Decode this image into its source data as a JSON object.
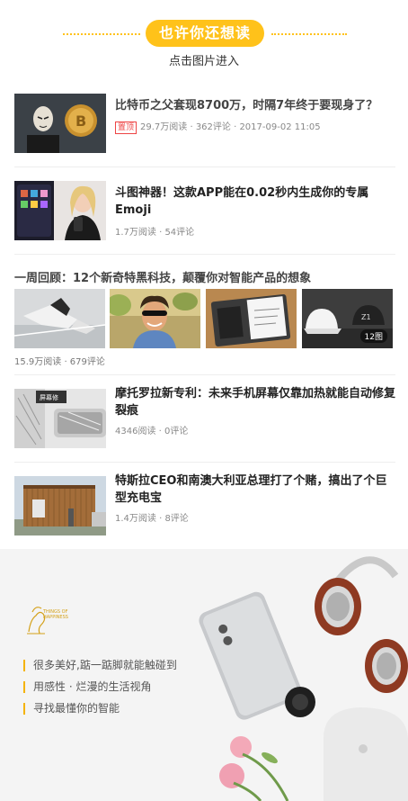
{
  "header": {
    "pill_label": "也许你还想读",
    "subtitle": "点击图片进入"
  },
  "articles": [
    {
      "title": "比特币之父套现8700万，时隔7年终于要现身了？",
      "tag": "置顶",
      "meta": "29.7万阅读 · 362评论 · 2017-09-02 11:05"
    },
    {
      "title": "斗图神器！这款APP能在0.02秒内生成你的专属Emoji",
      "meta": "1.7万阅读 · 54评论"
    },
    {
      "title": "摩托罗拉新专利：未来手机屏幕仅靠加热就能自动修复裂痕",
      "meta": "4346阅读 · 0评论"
    },
    {
      "title": "特斯拉CEO和南澳大利亚总理打了个赌，搞出了个巨型充电宝",
      "meta": "1.4万阅读 · 8评论"
    }
  ],
  "gallery": {
    "title": "一周回顾：12个新奇特黑科技，颠覆你对智能产品的想象",
    "badge": "12图",
    "meta": "15.9万阅读 · 679评论"
  },
  "banner": {
    "logo_text": "THINGS OF HAPPINESS",
    "lines": [
      "很多美好,踮一踮脚就能触碰到",
      "用感性 · 烂漫的生活视角",
      "寻找最懂你的智能"
    ]
  },
  "colors": {
    "accent": "#ffc21a",
    "tag_red": "#ee4444"
  }
}
